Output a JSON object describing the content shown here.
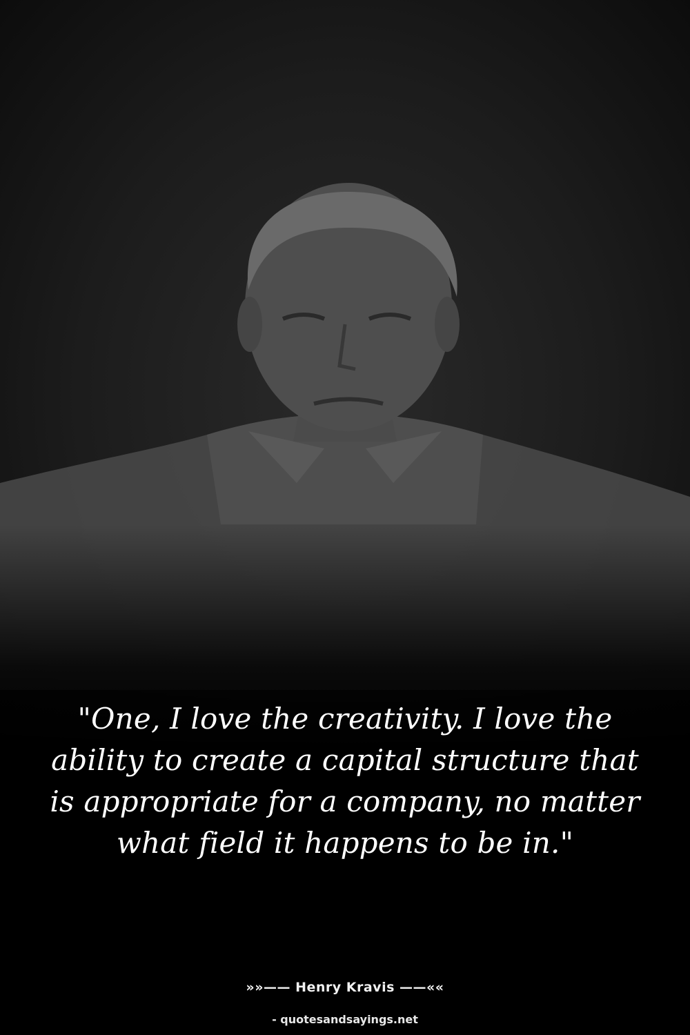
{
  "quote": {
    "text": "\"One, I love the creativity. I love the ability to create a capital structure that is appropriate for a company, no matter what field it happens to be in.\""
  },
  "author": {
    "line": "»»—— Henry Kravis ——««"
  },
  "source": {
    "label": "- quotesandsayings.net"
  },
  "colors": {
    "background": "#000000",
    "text": "#ffffff"
  }
}
